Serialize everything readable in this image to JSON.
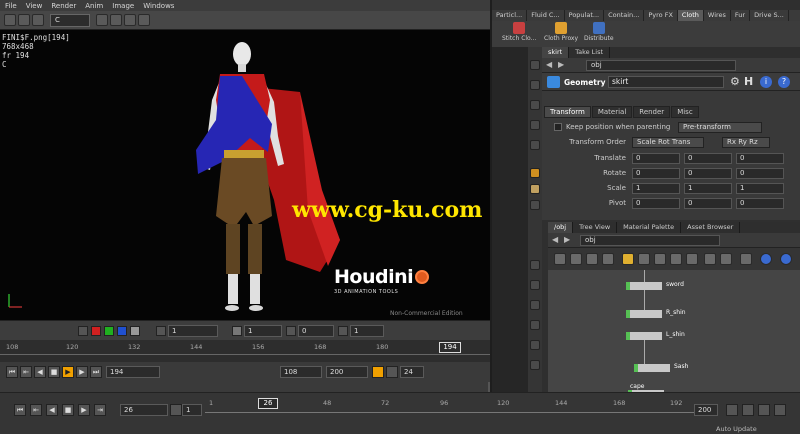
{
  "menu": [
    "File",
    "View",
    "Render",
    "Anim",
    "Image",
    "Windows"
  ],
  "viewer": {
    "combo": "C",
    "info": [
      "FINI$F.png[194]",
      "768x468",
      "fr 194",
      "C"
    ],
    "logo": "Houdini",
    "logo_sub": "3D ANIMATION TOOLS",
    "edition": "Non-Commercial Edition",
    "watermark": "www.cg-ku.com",
    "bottom_fields": [
      "1",
      "1",
      "0",
      "1"
    ],
    "timeline_ticks": [
      "108",
      "120",
      "132",
      "144",
      "156",
      "168",
      "180"
    ],
    "timeline_current": "194",
    "playback": {
      "frame": "194",
      "start": "108",
      "end": "200",
      "step": "24"
    }
  },
  "shelf": {
    "tabs": [
      "Particl...",
      "Fluid C...",
      "Populat...",
      "Contain...",
      "Pyro FX",
      "Cloth",
      "Wires",
      "Fur",
      "Drive S..."
    ],
    "active_tab": "Cloth",
    "tools": [
      "Stitch Clo...",
      "Cloth Proxy",
      "Distribute"
    ]
  },
  "params": {
    "pane_tabs": [
      "skirt",
      "Take List"
    ],
    "path": "obj",
    "type": "Geometry",
    "name": "skirt",
    "tabs": [
      "Transform",
      "Material",
      "Render",
      "Misc"
    ],
    "active_tab": "Transform",
    "keep_position": "Keep position when parenting",
    "keep_value": "Pre-transform",
    "transform_order_label": "Transform Order",
    "transform_order": "Scale Rot Trans",
    "rot_order": "Rx Ry Rz",
    "rows": [
      {
        "label": "Translate",
        "values": [
          "0",
          "0",
          "0"
        ]
      },
      {
        "label": "Rotate",
        "values": [
          "0",
          "0",
          "0"
        ]
      },
      {
        "label": "Scale",
        "values": [
          "1",
          "1",
          "1"
        ]
      },
      {
        "label": "Pivot",
        "values": [
          "0",
          "0",
          "0"
        ]
      }
    ]
  },
  "network": {
    "pane_tabs": [
      "/obj",
      "Tree View",
      "Material Palette",
      "Asset Browser"
    ],
    "path": "obj",
    "nodes": [
      "sword",
      "R_shin",
      "L_shin",
      "Sash",
      "cape"
    ]
  },
  "playbar": {
    "frame": "26",
    "step": "1",
    "start": "1",
    "ticks": [
      "24",
      "48",
      "72",
      "96",
      "120",
      "144",
      "168",
      "192"
    ],
    "current": "26",
    "end": "200",
    "auto_update": "Auto Update"
  },
  "colors": {
    "accent": "#f0a000",
    "node_flag": "#56c054",
    "cape": "#c21818",
    "tunic": "#2a2ab0"
  }
}
